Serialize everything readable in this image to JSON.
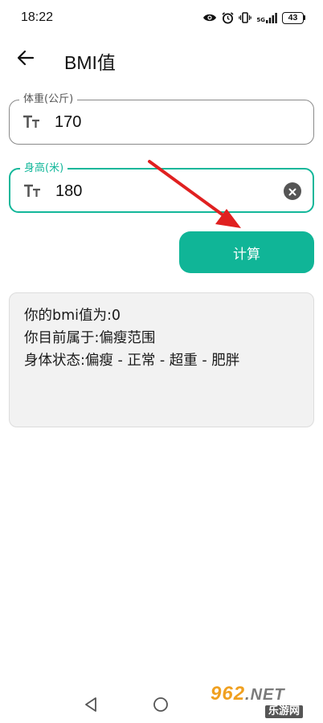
{
  "status_bar": {
    "time": "18:22",
    "network_label": "5G",
    "battery": "43"
  },
  "app_bar": {
    "title": "BMI值",
    "back_icon": "arrow-left-icon"
  },
  "weight_field": {
    "label": "体重(公斤)",
    "value": "170",
    "icon": "text-size-icon"
  },
  "height_field": {
    "label": "身高(米)",
    "value": "180",
    "icon": "text-size-icon",
    "clear_icon": "clear-circle-icon"
  },
  "calculate_button": {
    "label": "计算"
  },
  "result": {
    "line1": "你的bmi值为:0",
    "line2": "你目前属于:偏瘦范围",
    "line3": "身体状态:偏瘦 - 正常 - 超重 - 肥胖"
  },
  "watermark": {
    "main": "962",
    "suffix": ".NET",
    "sub": "乐游网"
  },
  "colors": {
    "accent": "#10b597",
    "focus_border": "#13b79a",
    "annotation_arrow": "#e02020",
    "card_background": "#f2f2f2"
  }
}
